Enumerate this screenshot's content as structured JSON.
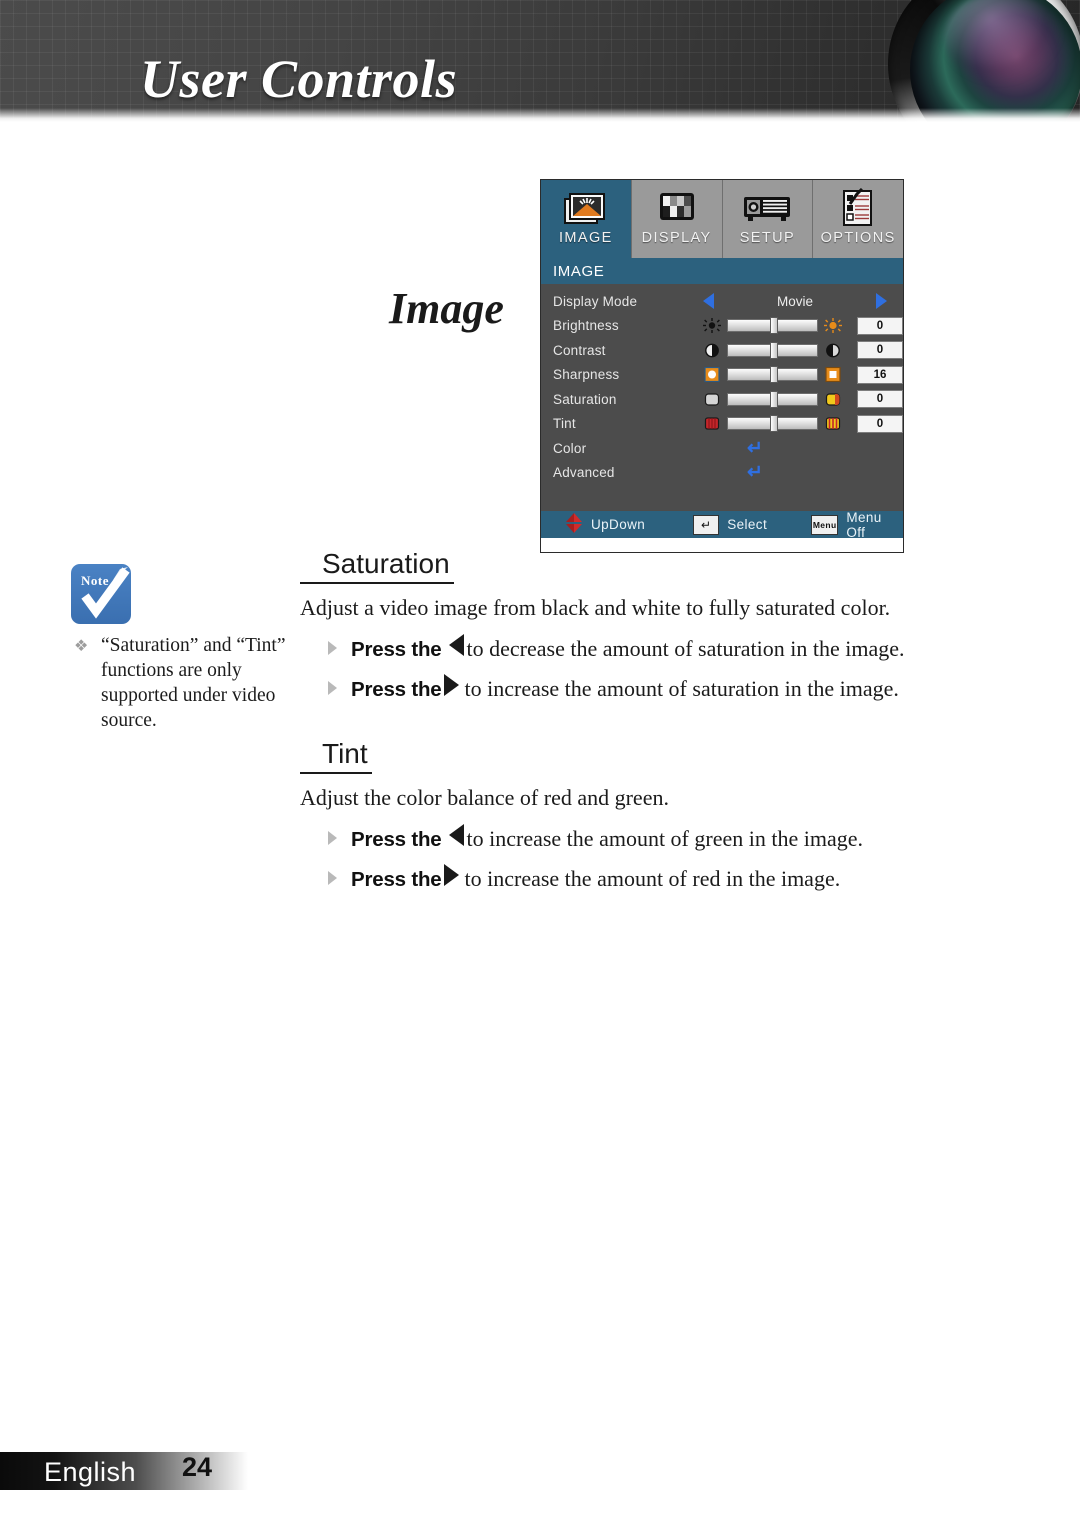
{
  "header": {
    "title": "User Controls",
    "lens_icon": "camera-lens-icon"
  },
  "page_title": "Image",
  "osd": {
    "tabs": [
      {
        "label": "IMAGE",
        "icon": "image-tab-icon",
        "active": true
      },
      {
        "label": "DISPLAY",
        "icon": "display-tab-icon",
        "active": false
      },
      {
        "label": "SETUP",
        "icon": "setup-projector-tab-icon",
        "active": false
      },
      {
        "label": "OPTIONS",
        "icon": "options-checklist-tab-icon",
        "active": false
      }
    ],
    "section_title": "IMAGE",
    "rows": [
      {
        "label": "Display Mode",
        "type": "select",
        "value": "Movie"
      },
      {
        "label": "Brightness",
        "type": "slider",
        "value": "0",
        "left_icon": "brightness-low-icon",
        "right_icon": "brightness-high-icon"
      },
      {
        "label": "Contrast",
        "type": "slider",
        "value": "0",
        "left_icon": "contrast-low-icon",
        "right_icon": "contrast-high-icon"
      },
      {
        "label": "Sharpness",
        "type": "slider",
        "value": "16",
        "left_icon": "sharpness-low-icon",
        "right_icon": "sharpness-high-icon"
      },
      {
        "label": "Saturation",
        "type": "slider",
        "value": "0",
        "left_icon": "saturation-low-icon",
        "right_icon": "saturation-high-icon"
      },
      {
        "label": "Tint",
        "type": "slider",
        "value": "0",
        "left_icon": "tint-low-icon",
        "right_icon": "tint-high-icon"
      },
      {
        "label": "Color",
        "type": "submenu",
        "enter_glyph": "↵"
      },
      {
        "label": "Advanced",
        "type": "submenu",
        "enter_glyph": "↵"
      }
    ],
    "footer": {
      "updown_label": "UpDown",
      "updown_icon": "up-down-arrow-icon",
      "select_label": "Select",
      "select_key": "↵",
      "menuoff_label": "Menu Off",
      "menu_key": "Menu"
    },
    "colors": {
      "accent": "#2c617e",
      "body": "#4c4c4c",
      "tab_inactive": "#9a9a9a",
      "arrow_blue": "#2f6fe0"
    }
  },
  "note": {
    "badge_label": "Note",
    "badge_icon": "note-check-icon",
    "bullet": "❖",
    "text": "“Saturation” and “Tint” functions are only supported under video source."
  },
  "sections": [
    {
      "heading": "Saturation",
      "paragraph": "Adjust a video image from black and white to fully saturated color.",
      "bullets": [
        {
          "press": "Press the",
          "arrow": "left",
          "text": "to decrease the amount of saturation in the image."
        },
        {
          "press": "Press the",
          "arrow": "right",
          "text": "to increase the amount of saturation in the image."
        }
      ]
    },
    {
      "heading": "Tint",
      "paragraph": "Adjust the color balance of red and green.",
      "bullets": [
        {
          "press": "Press the",
          "arrow": "left",
          "text": "to increase the amount of green in the image."
        },
        {
          "press": "Press the",
          "arrow": "right",
          "text": "to increase the amount of red in the image."
        }
      ]
    }
  ],
  "footer": {
    "language": "English",
    "page_number": "24"
  }
}
